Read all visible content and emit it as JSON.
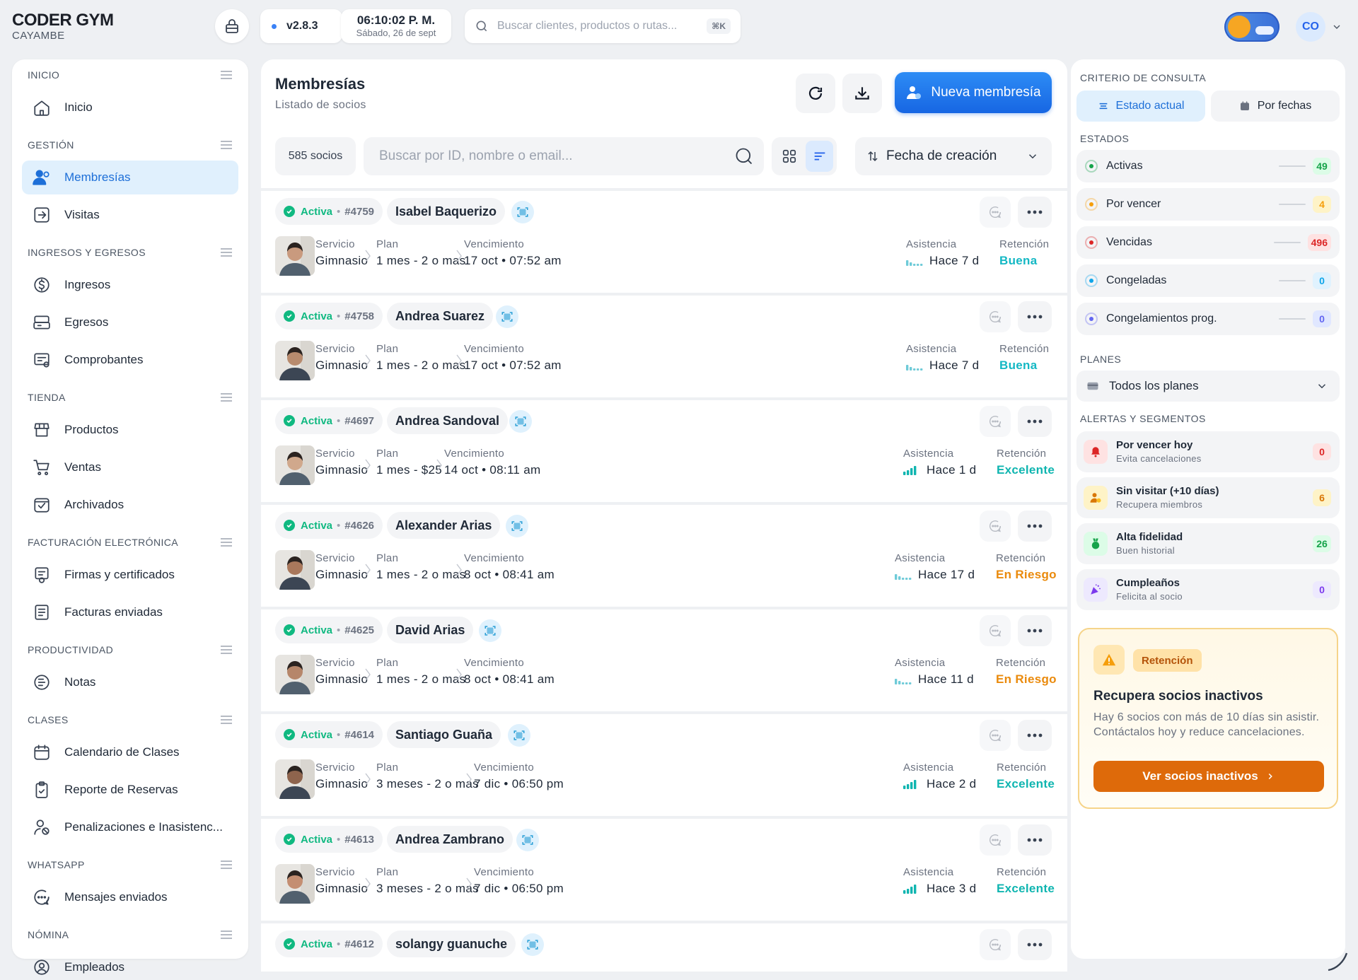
{
  "brand": {
    "name": "CODER GYM",
    "sub": "CAYAMBE"
  },
  "header": {
    "version": "v2.8.3",
    "time": "06:10:02 P. M.",
    "date": "Sábado, 26 de sept",
    "search_placeholder": "Buscar clientes, productos o rutas...",
    "search_shortcut": "⌘K",
    "user_initials": "CO"
  },
  "sidebar": {
    "sections": [
      {
        "label": "INICIO",
        "items": [
          {
            "label": "Inicio",
            "icon": "home-icon"
          }
        ]
      },
      {
        "label": "GESTIÓN",
        "items": [
          {
            "label": "Membresías",
            "icon": "users-icon",
            "active": true
          },
          {
            "label": "Visitas",
            "icon": "door-enter-icon"
          }
        ]
      },
      {
        "label": "INGRESOS Y EGRESOS",
        "items": [
          {
            "label": "Ingresos",
            "icon": "dollar-icon"
          },
          {
            "label": "Egresos",
            "icon": "cash-register-icon"
          },
          {
            "label": "Comprobantes",
            "icon": "receipt-icon"
          }
        ]
      },
      {
        "label": "TIENDA",
        "items": [
          {
            "label": "Productos",
            "icon": "store-icon"
          },
          {
            "label": "Ventas",
            "icon": "cart-icon"
          },
          {
            "label": "Archivados",
            "icon": "archive-check-icon"
          }
        ]
      },
      {
        "label": "FACTURACIÓN ELECTRÓNICA",
        "items": [
          {
            "label": "Firmas y certificados",
            "icon": "certificate-icon"
          },
          {
            "label": "Facturas enviadas",
            "icon": "invoice-icon"
          }
        ]
      },
      {
        "label": "PRODUCTIVIDAD",
        "items": [
          {
            "label": "Notas",
            "icon": "notes-icon"
          }
        ]
      },
      {
        "label": "CLASES",
        "items": [
          {
            "label": "Calendario de Clases",
            "icon": "calendar-icon"
          },
          {
            "label": "Reporte de Reservas",
            "icon": "clipboard-check-icon"
          },
          {
            "label": "Penalizaciones e Inasistenc...",
            "icon": "user-penalty-icon"
          }
        ]
      },
      {
        "label": "WHATSAPP",
        "items": [
          {
            "label": "Mensajes enviados",
            "icon": "chat-icon"
          }
        ]
      },
      {
        "label": "NÓMINA",
        "items": [
          {
            "label": "Empleados",
            "icon": "user-circle-icon"
          }
        ]
      }
    ]
  },
  "main": {
    "title": "Membresías",
    "subtitle": "Listado de socios",
    "new_button": "Nueva membresía",
    "count": "585 socios",
    "search_placeholder": "Buscar por ID, nombre o email...",
    "sort_label": "Fecha de creación",
    "field_labels": {
      "service": "Servicio",
      "plan": "Plan",
      "due": "Vencimiento",
      "attendance": "Asistencia",
      "retention": "Retención"
    },
    "members": [
      {
        "state": "Activa",
        "id": "#4759",
        "name": "Isabel Baquerizo",
        "service": "Gimnasio",
        "plan": "1 mes - 2 o mas",
        "due": "17 oct • 07:52 am",
        "attendance": "Hace 7 d",
        "bars": 1,
        "retention": "Buena",
        "ret_color": "#14b8c4"
      },
      {
        "state": "Activa",
        "id": "#4758",
        "name": "Andrea Suarez",
        "service": "Gimnasio",
        "plan": "1 mes - 2 o mas",
        "due": "17 oct • 07:52 am",
        "attendance": "Hace 7 d",
        "bars": 1,
        "retention": "Buena",
        "ret_color": "#14b8c4"
      },
      {
        "state": "Activa",
        "id": "#4697",
        "name": "Andrea Sandoval",
        "service": "Gimnasio",
        "plan": "1 mes - $25",
        "due": "14 oct • 08:11 am",
        "attendance": "Hace 1 d",
        "bars": 4,
        "retention": "Excelente",
        "ret_color": "#0fb5b0"
      },
      {
        "state": "Activa",
        "id": "#4626",
        "name": "Alexander Arias",
        "service": "Gimnasio",
        "plan": "1 mes - 2 o mas",
        "due": "8 oct • 08:41 am",
        "attendance": "Hace 17 d",
        "bars": 1,
        "retention": "En Riesgo",
        "ret_color": "#ea8a0c"
      },
      {
        "state": "Activa",
        "id": "#4625",
        "name": "David Arias",
        "service": "Gimnasio",
        "plan": "1 mes - 2 o mas",
        "due": "8 oct • 08:41 am",
        "attendance": "Hace 11 d",
        "bars": 1,
        "retention": "En Riesgo",
        "ret_color": "#ea8a0c"
      },
      {
        "state": "Activa",
        "id": "#4614",
        "name": "Santiago Guaña",
        "service": "Gimnasio",
        "plan": "3 meses - 2 o mas",
        "due": "7 dic • 06:50 pm",
        "attendance": "Hace 2 d",
        "bars": 4,
        "retention": "Excelente",
        "ret_color": "#0fb5b0"
      },
      {
        "state": "Activa",
        "id": "#4613",
        "name": "Andrea Zambrano",
        "service": "Gimnasio",
        "plan": "3 meses - 2 o mas",
        "due": "7 dic • 06:50 pm",
        "attendance": "Hace 3 d",
        "bars": 4,
        "retention": "Excelente",
        "ret_color": "#0fb5b0"
      },
      {
        "state": "Activa",
        "id": "#4612",
        "name": "solangy guanuche"
      }
    ]
  },
  "right": {
    "criteria_label": "CRITERIO DE CONSULTA",
    "seg_current": "Estado actual",
    "seg_dates": "Por fechas",
    "states_label": "ESTADOS",
    "states": [
      {
        "label": "Activas",
        "count": "49",
        "color": "#16a34a",
        "bg": "#dcfce7"
      },
      {
        "label": "Por vencer",
        "count": "4",
        "color": "#f59e0b",
        "bg": "#fef3c7"
      },
      {
        "label": "Vencidas",
        "count": "496",
        "color": "#dc2626",
        "bg": "#fee2e2"
      },
      {
        "label": "Congeladas",
        "count": "0",
        "color": "#0ea5e9",
        "bg": "#e0f2fe"
      },
      {
        "label": "Congelamientos prog.",
        "count": "0",
        "color": "#6366f1",
        "bg": "#e0e7ff"
      }
    ],
    "plans_label": "PLANES",
    "plans_value": "Todos los planes",
    "alerts_label": "ALERTAS Y SEGMENTOS",
    "alerts": [
      {
        "title": "Por vencer hoy",
        "sub": "Evita cancelaciones",
        "count": "0",
        "color": "#dc2626",
        "bg": "#fee2e2",
        "icon": "bell-icon"
      },
      {
        "title": "Sin visitar (+10 días)",
        "sub": "Recupera miembros",
        "count": "6",
        "color": "#d97706",
        "bg": "#fef3c7",
        "icon": "user-clock-icon"
      },
      {
        "title": "Alta fidelidad",
        "sub": "Buen historial",
        "count": "26",
        "color": "#16a34a",
        "bg": "#dcfce7",
        "icon": "medal-icon"
      },
      {
        "title": "Cumpleaños",
        "sub": "Felicita al socio",
        "count": "0",
        "color": "#7c3aed",
        "bg": "#ede9fe",
        "icon": "party-icon"
      }
    ],
    "promo": {
      "tag": "Retención",
      "title": "Recupera socios inactivos",
      "body": "Hay 6 socios con más de 10 días sin asistir. Contáctalos hoy y reduce cancelaciones.",
      "cta": "Ver socios inactivos"
    }
  }
}
